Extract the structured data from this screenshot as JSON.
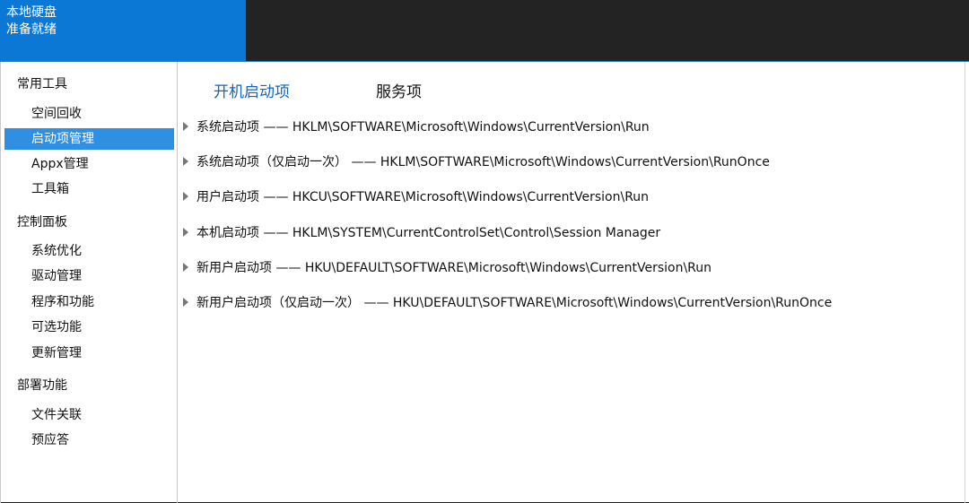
{
  "header": {
    "line1": "本地硬盘",
    "line2": "准备就绪"
  },
  "sidebar": {
    "groups": [
      {
        "title": "常用工具",
        "items": [
          {
            "label": "空间回收",
            "active": false
          },
          {
            "label": "启动项管理",
            "active": true
          },
          {
            "label": "Appx管理",
            "active": false
          },
          {
            "label": "工具箱",
            "active": false
          }
        ]
      },
      {
        "title": "控制面板",
        "items": [
          {
            "label": "系统优化",
            "active": false
          },
          {
            "label": "驱动管理",
            "active": false
          },
          {
            "label": "程序和功能",
            "active": false
          },
          {
            "label": "可选功能",
            "active": false
          },
          {
            "label": "更新管理",
            "active": false
          }
        ]
      },
      {
        "title": "部署功能",
        "items": [
          {
            "label": "文件关联",
            "active": false
          },
          {
            "label": "预应答",
            "active": false
          }
        ]
      }
    ]
  },
  "tabs": [
    {
      "label": "开机启动项",
      "active": true
    },
    {
      "label": "服务项",
      "active": false
    }
  ],
  "startup_entries": [
    "系统启动项 —— HKLM\\SOFTWARE\\Microsoft\\Windows\\CurrentVersion\\Run",
    "系统启动项（仅启动一次） —— HKLM\\SOFTWARE\\Microsoft\\Windows\\CurrentVersion\\RunOnce",
    "用户启动项 —— HKCU\\SOFTWARE\\Microsoft\\Windows\\CurrentVersion\\Run",
    "本机启动项 —— HKLM\\SYSTEM\\CurrentControlSet\\Control\\Session Manager",
    "新用户启动项 —— HKU\\DEFAULT\\SOFTWARE\\Microsoft\\Windows\\CurrentVersion\\Run",
    "新用户启动项（仅启动一次） —— HKU\\DEFAULT\\SOFTWARE\\Microsoft\\Windows\\CurrentVersion\\RunOnce"
  ],
  "icons": {
    "expand": "triangle-right-icon"
  },
  "colors": {
    "header_blue": "#0a78d4",
    "active_item": "#2f8fe3",
    "active_tab": "#1565c0",
    "dark_bar": "#232323"
  }
}
